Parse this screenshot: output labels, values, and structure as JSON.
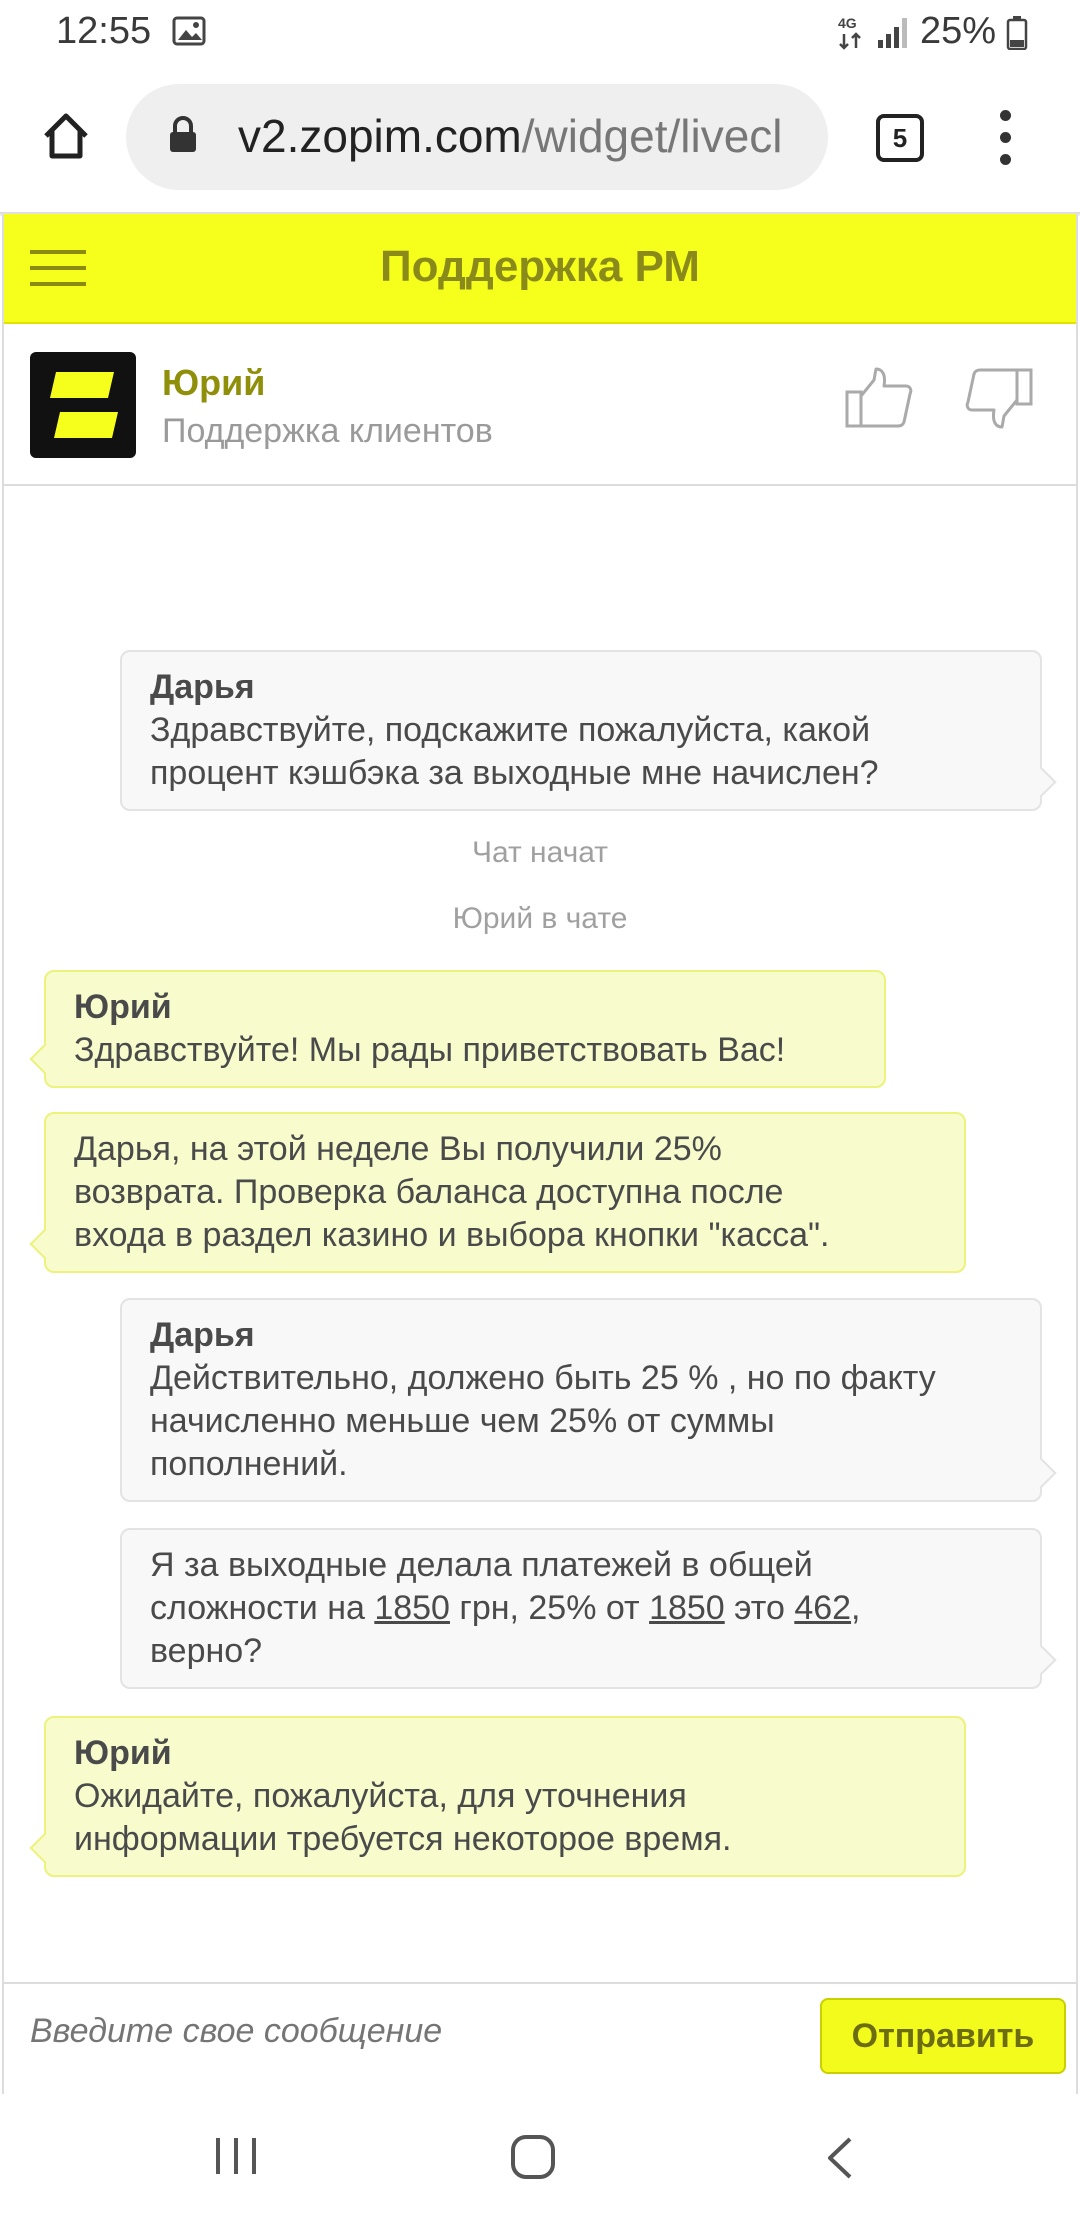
{
  "status_bar": {
    "time": "12:55",
    "network": "4G",
    "battery": "25%"
  },
  "browser": {
    "url_host": "v2.zopim.com",
    "url_path": "/widget/livecl",
    "tab_count": "5"
  },
  "widget": {
    "title": "Поддержка РМ",
    "agent": {
      "name": "Юрий",
      "role": "Поддержка клиентов"
    },
    "messages": [
      {
        "sender": "Дарья",
        "lines": [
          "Здравствуйте, подскажите пожалуйста, какой",
          "процент кэшбэка за выходные мне начислен?"
        ]
      },
      {
        "system": "Чат начат"
      },
      {
        "system": "Юрий в чате"
      },
      {
        "sender": "Юрий",
        "lines": [
          "Здравствуйте! Мы рады приветствовать Вас!"
        ]
      },
      {
        "lines": [
          "Дарья, на этой неделе Вы получили 25%",
          "возврата. Проверка баланса доступна после",
          "входа в раздел казино и выбора кнопки \"касса\"."
        ]
      },
      {
        "sender": "Дарья",
        "lines": [
          "Действительно,  должено быть 25 % , но по факту",
          "начисленно меньше чем 25% от суммы",
          "пополнений."
        ]
      },
      {
        "line1": "Я за выходные делала платежей в общей",
        "line2_a": "сложности на ",
        "line2_n1": "1850",
        "line2_b": " грн, 25% от ",
        "line2_n2": "1850",
        "line2_c": " это ",
        "line2_n3": "462",
        "line2_d": ",",
        "line3": "верно?"
      },
      {
        "sender": "Юрий",
        "lines": [
          "Ожидайте, пожалуйста, для уточнения",
          "информации требуется некоторое время."
        ]
      }
    ],
    "input_placeholder": "Введите свое сообщение",
    "send_label": "Отправить"
  },
  "colors": {
    "header_yellow": "#f6ff1c",
    "agent_bubble": "#f8fbcc",
    "visitor_bubble": "#f8f8f8",
    "accent_text": "#8f8f0a"
  }
}
